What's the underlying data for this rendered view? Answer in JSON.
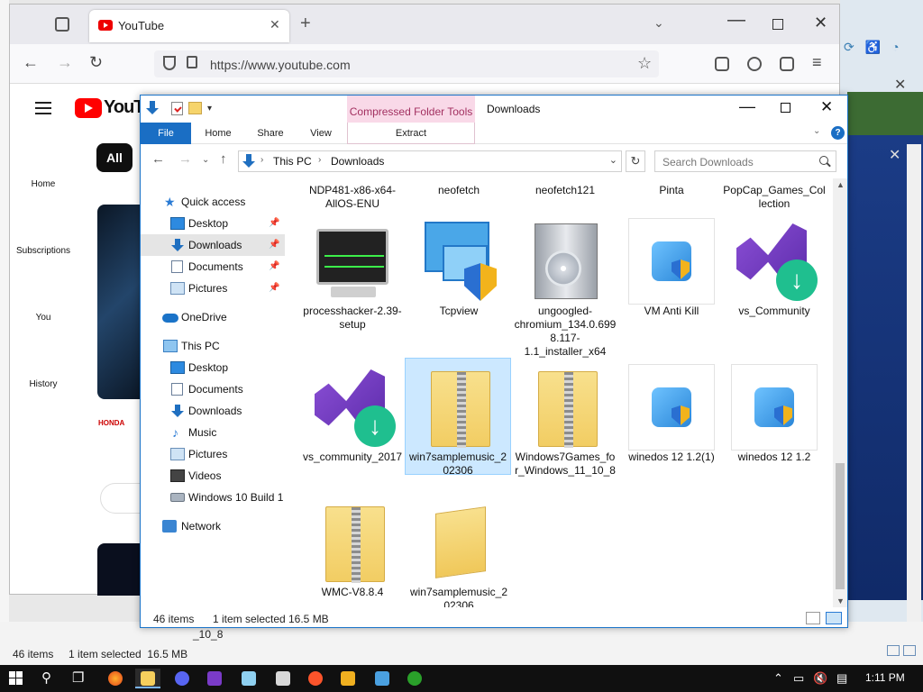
{
  "browser": {
    "tab_title": "YouTube",
    "url": "https://www.youtube.com",
    "youtube": {
      "logo_text": "YouTu",
      "chip_all": "All",
      "sidebar": [
        "Home",
        "Subscriptions",
        "You",
        "History"
      ],
      "brand": "HONDA"
    }
  },
  "explorer": {
    "title": "Downloads",
    "context_tab": "Compressed Folder Tools",
    "context_command": "Extract",
    "ribbon_tabs": [
      "File",
      "Home",
      "Share",
      "View"
    ],
    "breadcrumb": [
      "This PC",
      "Downloads"
    ],
    "search_placeholder": "Search Downloads",
    "nav": {
      "quick_access": "Quick access",
      "qa_items": [
        "Desktop",
        "Downloads",
        "Documents",
        "Pictures"
      ],
      "onedrive": "OneDrive",
      "this_pc": "This PC",
      "pc_items": [
        "Desktop",
        "Documents",
        "Downloads",
        "Music",
        "Pictures",
        "Videos",
        "Windows 10 Build 1"
      ],
      "network": "Network"
    },
    "top_row": [
      "NDP481-x86-x64-AllOS-ENU",
      "neofetch",
      "neofetch121",
      "Pinta",
      "PopCap_Games_Collection"
    ],
    "files": [
      {
        "name": "processhacker-2.39-setup",
        "icon": "monitor-icon"
      },
      {
        "name": "Tcpview",
        "icon": "tcpview-icon"
      },
      {
        "name": "ungoogled-chromium_134.0.6998.117-1.1_installer_x64",
        "icon": "installer-box-icon"
      },
      {
        "name": "VM Anti Kill",
        "icon": "setup-icon"
      },
      {
        "name": "vs_Community",
        "icon": "visual-studio-icon"
      },
      {
        "name": "vs_community_2017",
        "icon": "visual-studio-icon"
      },
      {
        "name": "win7samplemusic_202306",
        "icon": "zip-folder-icon"
      },
      {
        "name": "Windows7Games_for_Windows_11_10_8",
        "icon": "zip-folder-icon"
      },
      {
        "name": "winedos 12 1.2(1)",
        "icon": "setup-icon"
      },
      {
        "name": "winedos 12 1.2",
        "icon": "setup-icon"
      },
      {
        "name": "WMC-V8.8.4",
        "icon": "zip-folder-icon"
      },
      {
        "name": "win7samplemusic_202306",
        "icon": "folder-icon"
      }
    ],
    "status": {
      "count": "46 items",
      "selected": "1 item selected",
      "size": "16.5 MB"
    }
  },
  "background": {
    "status_text": "46 items     1 item selected  16.5 MB",
    "fragment": "_10_8"
  },
  "taskbar": {
    "time": "1:11 PM"
  }
}
